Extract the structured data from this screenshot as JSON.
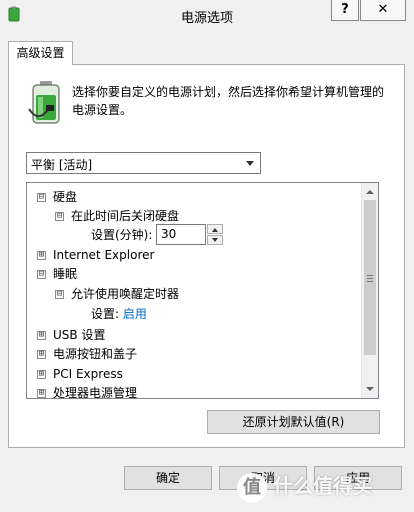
{
  "window": {
    "title": "电源选项",
    "help_label": "?",
    "close_label": "✕"
  },
  "tab": {
    "label": "高级设置"
  },
  "description": "选择你要自定义的电源计划，然后选择你希望计算机管理的电源设置。",
  "plan_select": {
    "value": "平衡 [活动]"
  },
  "tree": {
    "hard_disk": {
      "label": "硬盘",
      "expander": "⊟"
    },
    "turn_off_disk": {
      "label": "在此时间后关闭硬盘",
      "expander": "⊟"
    },
    "setting_minutes": {
      "label": "设置(分钟):",
      "value": "30"
    },
    "internet_explorer": {
      "label": "Internet Explorer",
      "expander": "⊞"
    },
    "sleep": {
      "label": "睡眠",
      "expander": "⊟"
    },
    "allow_wake_timers": {
      "label": "允许使用唤醒定时器",
      "expander": "⊟"
    },
    "wake_setting": {
      "label": "设置:",
      "value": "启用"
    },
    "usb": {
      "label": "USB 设置",
      "expander": "⊞"
    },
    "power_buttons": {
      "label": "电源按钮和盖子",
      "expander": "⊞"
    },
    "pci": {
      "label": "PCI Express",
      "expander": "⊞"
    },
    "processor": {
      "label": "处理器电源管理",
      "expander": "⊞"
    }
  },
  "buttons": {
    "restore": "还原计划默认值(R)",
    "ok": "确定",
    "cancel": "取消",
    "apply": "应用"
  },
  "watermark": {
    "badge": "值",
    "text": "什么值得买"
  },
  "colors": {
    "link": "#0066cc",
    "battery_green": "#3aa83a"
  }
}
